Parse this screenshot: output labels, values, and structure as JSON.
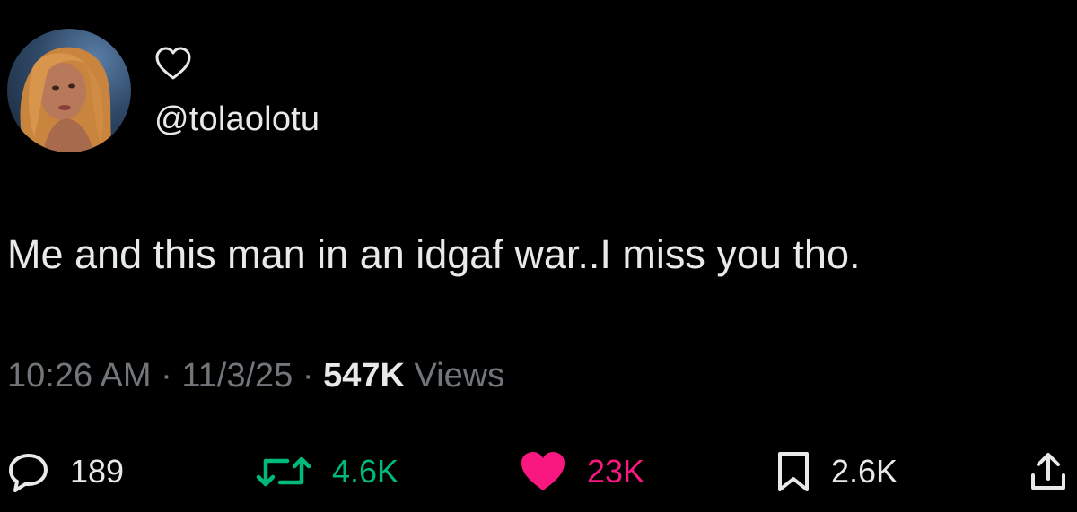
{
  "author": {
    "handle": "@tolaolotu"
  },
  "tweet": {
    "text": "Me and this man in an idgaf war..I miss you tho."
  },
  "meta": {
    "time": "10:26 AM",
    "sep1": " · ",
    "date": "11/3/25",
    "sep2": " · ",
    "views_count": "547K",
    "views_label": " Views"
  },
  "actions": {
    "replies": "189",
    "retweets": "4.6K",
    "likes": "23K",
    "bookmarks": "2.6K"
  },
  "icons": {
    "reply": "speech-bubble-icon",
    "retweet": "retweet-arrows-icon",
    "like": "filled-heart-icon",
    "bookmark": "bookmark-icon",
    "share": "share-upload-icon",
    "top_heart": "heart-outline-icon"
  },
  "colors": {
    "background": "#000000",
    "primary_text": "#e7e9ea",
    "secondary_text": "#71767b",
    "retweet_green": "#00ba7c",
    "like_pink": "#f91880"
  }
}
